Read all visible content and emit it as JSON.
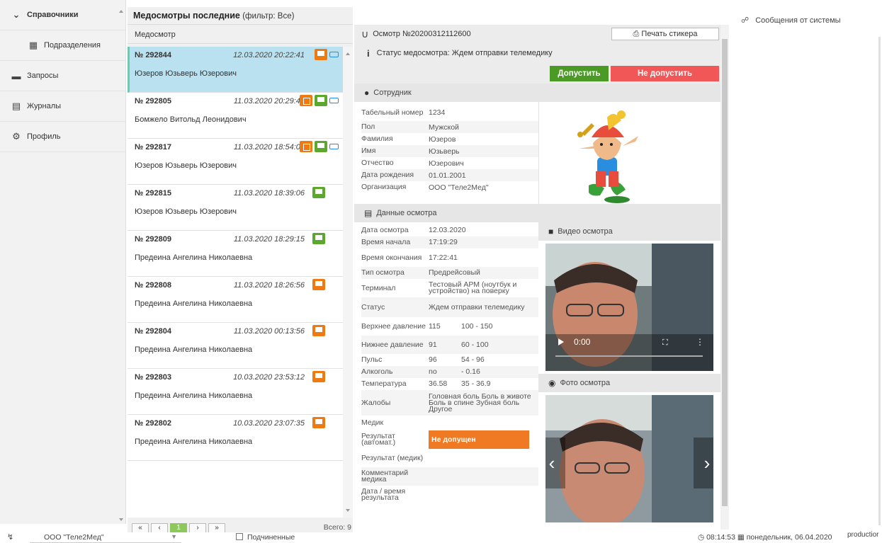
{
  "sidebar": {
    "items": [
      {
        "label": "Справочники",
        "icon": "chevron-down-icon"
      },
      {
        "label": "Подразделения",
        "icon": "building-icon"
      },
      {
        "label": "Запросы",
        "icon": "card-icon"
      },
      {
        "label": "Журналы",
        "icon": "book-icon"
      },
      {
        "label": "Профиль",
        "icon": "gear-icon"
      }
    ]
  },
  "list": {
    "title": "Медосмотры последние",
    "filter": "(фильтр: Все)",
    "column": "Медосмотр",
    "items": [
      {
        "num": "№ 292844",
        "date": "12.03.2020 20:22:41",
        "name": "Юзеров Юзьверь Юзерович"
      },
      {
        "num": "№ 292805",
        "date": "11.03.2020 20:29:45",
        "name": "Бомжело Витольд Леонидович"
      },
      {
        "num": "№ 292817",
        "date": "11.03.2020 18:54:03",
        "name": "Юзеров Юзьверь Юзерович"
      },
      {
        "num": "№ 292815",
        "date": "11.03.2020 18:39:06",
        "name": "Юзеров Юзьверь Юзерович"
      },
      {
        "num": "№ 292809",
        "date": "11.03.2020 18:29:15",
        "name": "Предеина Ангелина Николаевна"
      },
      {
        "num": "№ 292808",
        "date": "11.03.2020 18:26:56",
        "name": "Предеина Ангелина Николаевна"
      },
      {
        "num": "№ 292804",
        "date": "11.03.2020 00:13:56",
        "name": "Предеина Ангелина Николаевна"
      },
      {
        "num": "№ 292803",
        "date": "10.03.2020 23:53:12",
        "name": "Предеина Ангелина Николаевна"
      },
      {
        "num": "№ 292802",
        "date": "10.03.2020 23:07:35",
        "name": "Предеина Ангелина Николаевна"
      }
    ],
    "pager": {
      "first": "«",
      "prev": "‹",
      "current": "1",
      "next": "›",
      "last": "»",
      "total": "Всего: 9"
    }
  },
  "detail": {
    "exam_title": "Осмотр №20200312112600",
    "print_button": "Печать стикера",
    "status": "Статус медосмотра: Ждем отправки телемедику",
    "admit": "Допустить",
    "reject": "Не допустить",
    "employee_section": "Сотрудник",
    "employee": [
      {
        "k": "Табельный номер",
        "v": "1234"
      },
      {
        "k": "Пол",
        "v": "Мужской"
      },
      {
        "k": "Фамилия",
        "v": "Юзеров"
      },
      {
        "k": "Имя",
        "v": "Юзьверь"
      },
      {
        "k": "Отчество",
        "v": "Юзерович"
      },
      {
        "k": "Дата рождения",
        "v": "01.01.2001"
      },
      {
        "k": "Организация",
        "v": "ООО \"Теле2Мед\""
      }
    ],
    "exam_section": "Данные осмотра",
    "exam_rows": [
      {
        "k": "Дата осмотра",
        "v": "12.03.2020"
      },
      {
        "k": "Время начала",
        "v": "17:19:29"
      },
      {
        "k": "Время окончания",
        "v": "17:22:41"
      },
      {
        "k": "Тип осмотра",
        "v": "Предрейсовый"
      },
      {
        "k": "Терминал",
        "v": "Тестовый АРМ (ноутбук и устройство) на поверку"
      },
      {
        "k": "Статус",
        "v": "Ждем отправки телемедику"
      }
    ],
    "vitals": [
      {
        "k": "Верхнее давление",
        "v": "115",
        "r": "100 - 150"
      },
      {
        "k": "Нижнее давление",
        "v": "91",
        "r": "60 - 100"
      },
      {
        "k": "Пульс",
        "v": "96",
        "r": "54 - 96"
      },
      {
        "k": "Алкоголь",
        "v": "no",
        "r": "- 0.16"
      },
      {
        "k": "Температура",
        "v": "36.58",
        "r": "35 - 36.9"
      }
    ],
    "complaints": {
      "k": "Жалобы",
      "v": "Головная боль Боль в животе Боль в спине Зубная боль Другое"
    },
    "medic": {
      "k": "Медик",
      "v": ""
    },
    "result_auto": {
      "k": "Результат (автомат.)",
      "v": "Не допущен"
    },
    "result_medic": {
      "k": "Результат (медик)",
      "v": ""
    },
    "comment": {
      "k": "Комментарий медика",
      "v": ""
    },
    "result_time": {
      "k": "Дата / время результата",
      "v": ""
    },
    "video_section": "Видео осмотра",
    "video_time": "0:00",
    "photo_section": "Фото осмотра"
  },
  "messages": {
    "title": "Сообщения от системы"
  },
  "status": {
    "org": "ООО \"Теле2Мед\"",
    "subordinates": "Подчиненные",
    "time": "08:14:53",
    "date": "понедельник, 06.04.2020",
    "env": "productior"
  },
  "colors": {
    "accent_green": "#4a9a25",
    "reject_red": "#f25757",
    "badge_orange": "#ef7a23",
    "selected_row": "#b9e1f0"
  }
}
